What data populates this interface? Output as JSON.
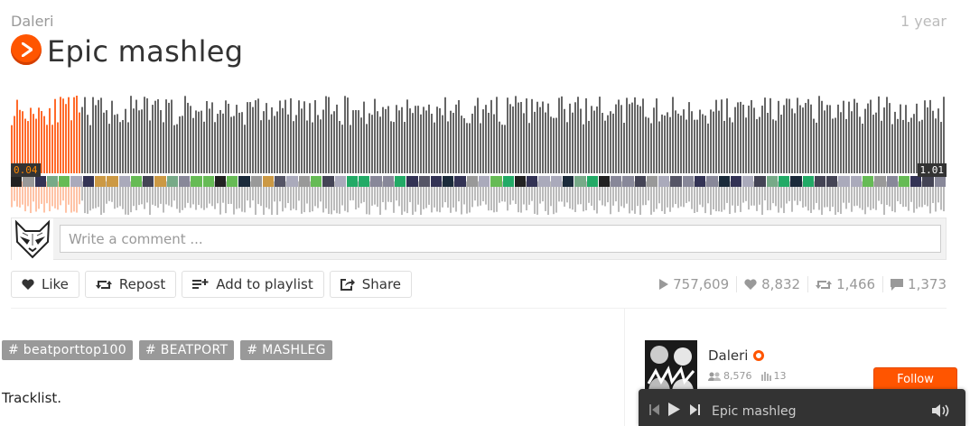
{
  "track": {
    "artist": "Daleri",
    "title": "Epic mashleg",
    "posted": "1 year"
  },
  "player": {
    "elapsed": "0.04",
    "duration": "1.01",
    "progress": 0.073
  },
  "comment": {
    "placeholder": "Write a comment ..."
  },
  "actions": {
    "like": "Like",
    "repost": "Repost",
    "add_to_playlist": "Add to playlist",
    "share": "Share"
  },
  "stats": {
    "plays": "757,609",
    "likes": "8,832",
    "reposts": "1,466",
    "comments": "1,373"
  },
  "tags": [
    "# beatporttop100",
    "# BEATPORT",
    "# MASHLEG"
  ],
  "description": "Tracklist.",
  "uploader": {
    "name": "Daleri",
    "followers": "8,576",
    "tracks": "13",
    "follow_label": "Follow"
  },
  "mini_player": {
    "track": "Epic mashleg"
  },
  "colors": {
    "accent": "#ff5500",
    "wave_played": "#ff6a2a",
    "wave_unplayed": "#666666",
    "reflection_unplayed": "#bbbbbb",
    "reflection_played": "#ffc3a6"
  }
}
